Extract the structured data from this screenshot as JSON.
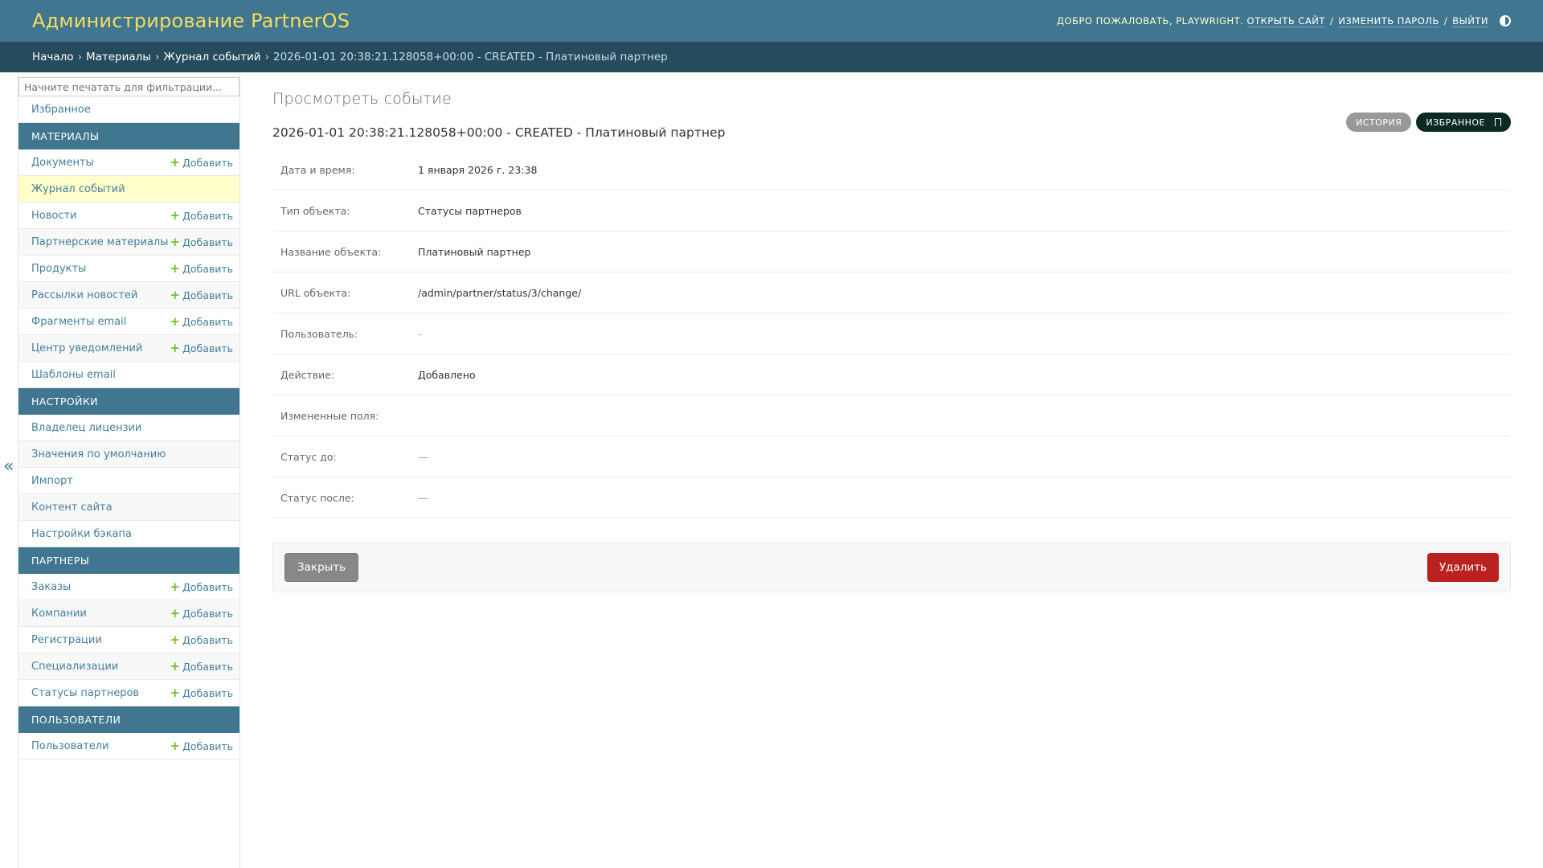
{
  "header": {
    "branding": "Администрирование PartnerOS",
    "welcome": "Добро пожаловать,",
    "username": "playwright",
    "view_site": "Открыть сайт",
    "change_password": "Изменить пароль",
    "logout": "Выйти",
    "separator": "/"
  },
  "breadcrumbs": {
    "items": [
      "Начало",
      "Материалы",
      "Журнал событий"
    ],
    "arrow": "›",
    "current": "2026-01-01 20:38:21.128058+00:00 - CREATED - Платиновый партнер"
  },
  "sidebar": {
    "filter_placeholder": "Начните печатать для фильтрации...",
    "favorites": "Избранное",
    "toggle": "«",
    "add_label": "Добавить",
    "modules": [
      {
        "caption": "Материалы",
        "items": [
          {
            "label": "Документы",
            "add": true
          },
          {
            "label": "Журнал событий",
            "add": false,
            "current": true
          },
          {
            "label": "Новости",
            "add": true
          },
          {
            "label": "Партнерские материалы",
            "add": true
          },
          {
            "label": "Продукты",
            "add": true
          },
          {
            "label": "Рассылки новостей",
            "add": true
          },
          {
            "label": "Фрагменты email",
            "add": true
          },
          {
            "label": "Центр уведомлений",
            "add": true
          },
          {
            "label": "Шаблоны email",
            "add": false
          }
        ]
      },
      {
        "caption": "Настройки",
        "items": [
          {
            "label": "Владелец лицензии",
            "add": false
          },
          {
            "label": "Значения по умолчанию",
            "add": false
          },
          {
            "label": "Импорт",
            "add": false
          },
          {
            "label": "Контент сайта",
            "add": false
          },
          {
            "label": "Настройки бэкапа",
            "add": false
          }
        ]
      },
      {
        "caption": "Партнеры",
        "items": [
          {
            "label": "Заказы",
            "add": true
          },
          {
            "label": "Компании",
            "add": true
          },
          {
            "label": "Регистрации",
            "add": true
          },
          {
            "label": "Специализации",
            "add": true
          },
          {
            "label": "Статусы партнеров",
            "add": true
          }
        ]
      },
      {
        "caption": "Пользователи",
        "items": [
          {
            "label": "Пользователи",
            "add": true
          }
        ]
      }
    ]
  },
  "content": {
    "page_title": "Просмотреть событие",
    "object_title": "2026-01-01 20:38:21.128058+00:00 - CREATED - Платиновый партнер",
    "tools": {
      "history": "История",
      "favorite": "Избранное"
    },
    "fields": [
      {
        "label": "Дата и время:",
        "value": "1 января 2026 г. 23:38"
      },
      {
        "label": "Тип объекта:",
        "value": "Статусы партнеров"
      },
      {
        "label": "Название объекта:",
        "value": "Платиновый партнер"
      },
      {
        "label": "URL объекта:",
        "value": "/admin/partner/status/3/change/"
      },
      {
        "label": "Пользователь:",
        "value": "-"
      },
      {
        "label": "Действие:",
        "value": "Добавлено"
      },
      {
        "label": "Измененные поля:",
        "value": ""
      },
      {
        "label": "Статус до:",
        "value": "—"
      },
      {
        "label": "Статус после:",
        "value": "—"
      }
    ],
    "buttons": {
      "close": "Закрыть",
      "delete": "Удалить"
    }
  },
  "colors": {
    "header_bg": "#417690",
    "breadcrumbs_bg": "#264b5d",
    "branding": "#f5dd5d",
    "link": "#447e9b",
    "add_plus": "#70bf2b",
    "delete": "#ba2121",
    "current_row": "#ffffcc"
  }
}
